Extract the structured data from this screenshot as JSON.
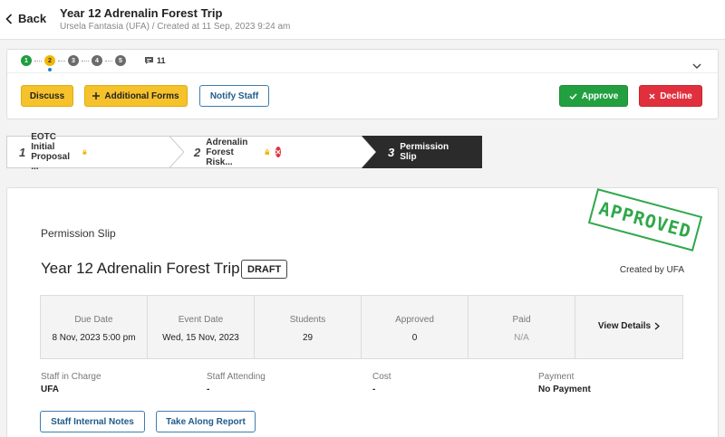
{
  "header": {
    "back_label": "Back",
    "title": "Year 12 Adrenalin Forest Trip",
    "subtitle": "Ursela Fantasia (UFA) / Created at 11 Sep, 2023 9:24 am"
  },
  "workflow": {
    "steps": [
      "1",
      "2",
      "3",
      "4",
      "5"
    ],
    "current_step": 2,
    "comment_count": "11",
    "buttons": {
      "discuss": "Discuss",
      "additional_forms": "Additional Forms",
      "notify_staff": "Notify Staff",
      "approve": "Approve",
      "decline": "Decline"
    }
  },
  "tabs": [
    {
      "num": "1",
      "label": "EOTC Initial Proposal ..."
    },
    {
      "num": "2",
      "label": "Adrenalin Forest Risk..."
    },
    {
      "num": "3",
      "label": "Permission Slip"
    }
  ],
  "card": {
    "stamp": "APPROVED",
    "section_label": "Permission Slip",
    "title": "Year 12 Adrenalin Forest Trip",
    "status_badge": "DRAFT",
    "created_by": "Created by UFA",
    "stats": [
      {
        "label": "Due Date",
        "value": "8 Nov, 2023 5:00 pm"
      },
      {
        "label": "Event Date",
        "value": "Wed, 15 Nov, 2023"
      },
      {
        "label": "Students",
        "value": "29"
      },
      {
        "label": "Approved",
        "value": "0"
      },
      {
        "label": "Paid",
        "value": "N/A"
      }
    ],
    "view_details": "View Details",
    "info": [
      {
        "label": "Staff in Charge",
        "value": "UFA"
      },
      {
        "label": "Staff Attending",
        "value": "-"
      },
      {
        "label": "Cost",
        "value": "-"
      },
      {
        "label": "Payment",
        "value": "No Payment"
      }
    ],
    "staff_notes_button": "Staff Internal Notes",
    "take_along_button": "Take Along Report"
  },
  "colors": {
    "approve": "#22a040",
    "decline": "#e0303d",
    "accent_yellow": "#f6c22c",
    "link_blue": "#1f5c8c",
    "active_tab": "#2b2b2b"
  }
}
